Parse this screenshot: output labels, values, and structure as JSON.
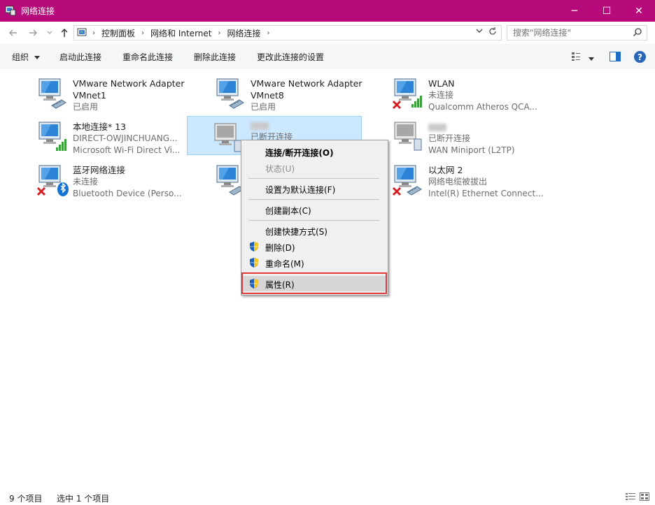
{
  "window": {
    "title": "网络连接",
    "minimize": "─",
    "maximize": "☐",
    "close": "✕"
  },
  "address": {
    "crumbs": [
      "控制面板",
      "网络和 Internet",
      "网络连接"
    ],
    "search_placeholder": "搜索\"网络连接\""
  },
  "toolbar": {
    "organize": "组织",
    "enable": "启动此连接",
    "rename": "重命名此连接",
    "delete": "删除此连接",
    "change": "更改此连接的设置"
  },
  "connections": [
    {
      "name": "VMware Network Adapter",
      "line2": "VMnet1",
      "line3": "已启用",
      "icon": "ethernet-icon"
    },
    {
      "name": "VMware Network Adapter",
      "line2": "VMnet8",
      "line3": "已启用",
      "icon": "ethernet-icon"
    },
    {
      "name": "WLAN",
      "line2": "未连接",
      "line3": "Qualcomm Atheros QCA...",
      "icon": "wifi-disconnected-icon"
    },
    {
      "name": "本地连接* 13",
      "line2": "DIRECT-OWJINCHUANG...",
      "line3": "Microsoft Wi-Fi Direct Vi...",
      "icon": "wifi-direct-icon"
    },
    {
      "name": "",
      "line2": "已断开连接",
      "line3": "",
      "icon": "vpn-icon"
    },
    {
      "name": "",
      "line2": "已断开连接",
      "line3": "WAN Miniport (L2TP)",
      "icon": "vpn-icon"
    },
    {
      "name": "蓝牙网络连接",
      "line2": "未连接",
      "line3": "Bluetooth Device (Perso...",
      "icon": "bluetooth-icon"
    },
    {
      "name": "",
      "line2": "",
      "line3": "",
      "icon": "ethernet-icon"
    },
    {
      "name": "以太网 2",
      "line2": "网络电缆被拔出",
      "line3": "Intel(R) Ethernet Connect...",
      "icon": "ethernet-unplugged-icon"
    }
  ],
  "context_menu": {
    "connect": "连接/断开连接(O)",
    "status": "状态(U)",
    "set_default": "设置为默认连接(F)",
    "copy": "创建副本(C)",
    "shortcut": "创建快捷方式(S)",
    "delete": "删除(D)",
    "rename": "重命名(M)",
    "properties": "属性(R)"
  },
  "status": {
    "count": "9 个项目",
    "selected": "选中 1 个项目"
  },
  "colors": {
    "titlebar": "#b80b7b",
    "selection": "#cce8ff",
    "highlight_box": "#e03a3a"
  }
}
